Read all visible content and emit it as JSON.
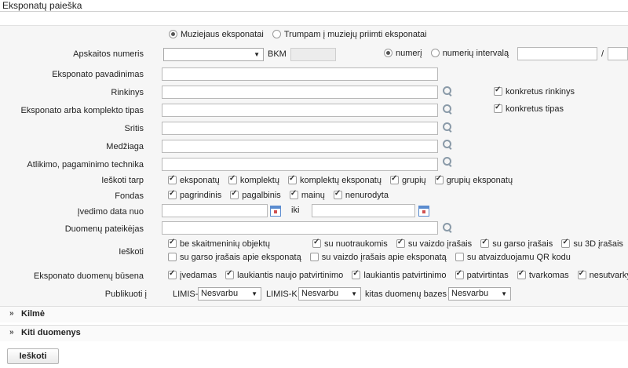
{
  "title": "Eksponatų paieška",
  "type_radios": [
    {
      "label": "Muziejaus eksponatai",
      "selected": true
    },
    {
      "label": "Trumpam į muziejų priimti eksponatai",
      "selected": false
    }
  ],
  "fields": {
    "apskaitos": "Apskaitos numeris",
    "bkm": "BKM",
    "pavadinimas": "Eksponato pavadinimas",
    "rinkinys": "Rinkinys",
    "tipas": "Eksponato arba komplekto tipas",
    "sritis": "Sritis",
    "medziaga": "Medžiaga",
    "technika": "Atlikimo, pagaminimo technika",
    "ieskoti_tarp": "Ieškoti tarp",
    "fondas": "Fondas",
    "ivedimo_data": "Įvedimo data nuo",
    "iki": "iki",
    "pateikejas": "Duomenų pateikėjas",
    "ieskoti": "Ieškoti",
    "busena": "Eksponato duomenų būsena",
    "publikuoti": "Publikuoti į"
  },
  "number_mode": [
    {
      "label": "numerį",
      "selected": true
    },
    {
      "label": "numerių intervalą",
      "selected": false
    }
  ],
  "range_sep": "/",
  "right_checks": [
    {
      "label": "konkretus rinkinys",
      "checked": true
    },
    {
      "label": "konkretus tipas",
      "checked": true
    }
  ],
  "search_among": [
    {
      "label": "eksponatų",
      "checked": true
    },
    {
      "label": "komplektų",
      "checked": true
    },
    {
      "label": "komplektų eksponatų",
      "checked": true
    },
    {
      "label": "grupių",
      "checked": true
    },
    {
      "label": "grupių eksponatų",
      "checked": true
    }
  ],
  "fondas": [
    {
      "label": "pagrindinis",
      "checked": true
    },
    {
      "label": "pagalbinis",
      "checked": true
    },
    {
      "label": "mainų",
      "checked": true
    },
    {
      "label": "nenurodyta",
      "checked": true
    }
  ],
  "search_row1": [
    {
      "label": "be skaitmeninių objektų",
      "checked": true
    },
    {
      "label": "su nuotraukomis",
      "checked": true
    },
    {
      "label": "su vaizdo įrašais",
      "checked": true
    },
    {
      "label": "su garso įrašais",
      "checked": true
    },
    {
      "label": "su 3D įrašais",
      "checked": true
    }
  ],
  "search_row2": [
    {
      "label": "su garso įrašais apie eksponatą",
      "checked": false
    },
    {
      "label": "su vaizdo įrašais apie eksponatą",
      "checked": false
    },
    {
      "label": "su atvaizduojamu QR kodu",
      "checked": false
    }
  ],
  "status": [
    {
      "label": "įvedamas",
      "checked": true
    },
    {
      "label": "laukiantis naujo patvirtinimo",
      "checked": true
    },
    {
      "label": "laukiantis patvirtinimo",
      "checked": true
    },
    {
      "label": "patvirtintas",
      "checked": true
    },
    {
      "label": "tvarkomas",
      "checked": true
    },
    {
      "label": "nesutvarkytas",
      "checked": true
    }
  ],
  "publish": {
    "limis_c": "LIMIS-C",
    "limis_k": "LIMIS-K",
    "kitas": "kitas duomenų bazes",
    "value": "Nesvarbu"
  },
  "sections": [
    "Kilmė",
    "Kiti duomenys"
  ],
  "submit": "Ieškoti"
}
